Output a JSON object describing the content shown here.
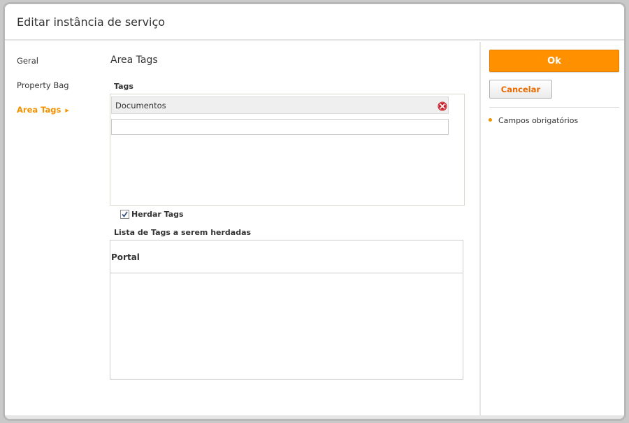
{
  "dialog": {
    "title": "Editar instância de serviço"
  },
  "nav": {
    "items": [
      {
        "label": "Geral",
        "active": false
      },
      {
        "label": "Property Bag",
        "active": false
      },
      {
        "label": "Area Tags",
        "active": true
      }
    ]
  },
  "content": {
    "section_title": "Area Tags",
    "tags_label": "Tags",
    "tags": [
      "Documentos"
    ],
    "tag_input_value": "",
    "inherit_checkbox": {
      "label": "Herdar Tags",
      "checked": true
    },
    "inherit_list_label": "Lista de Tags a serem herdadas",
    "inherit_list_items": [
      "Portal"
    ]
  },
  "actions": {
    "ok_label": "Ok",
    "cancel_label": "Cancelar",
    "required_note": "Campos obrigatórios"
  },
  "colors": {
    "accent": "#ff9100",
    "accent_text": "#f39200",
    "remove_icon": "#c0161f"
  },
  "icons": {
    "remove": "remove-circle-icon",
    "check": "checkmark-icon",
    "nav_arrow": "triangle-right-icon",
    "bullet": "bullet-dot-icon"
  }
}
